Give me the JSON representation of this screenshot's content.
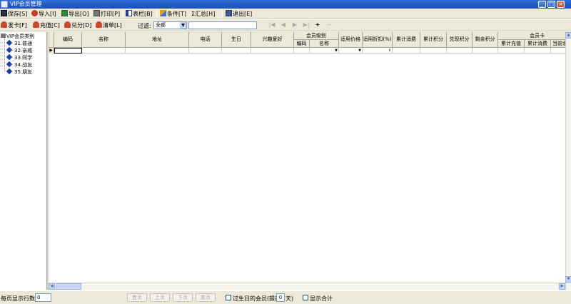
{
  "window": {
    "title": "VIP会员管理",
    "min": "_",
    "max": "□",
    "close": "×"
  },
  "toolbar1": [
    {
      "label": "保存[S]",
      "icon": "save-icon"
    },
    {
      "label": "导入[I]",
      "icon": "import-icon"
    },
    {
      "label": "导出[O]",
      "icon": "export-icon"
    },
    {
      "label": "打印[P]",
      "icon": "print-icon"
    },
    {
      "label": "表栏[B]",
      "icon": "columns-icon"
    },
    {
      "label": "条件[T]",
      "icon": "condition-icon"
    },
    {
      "label": "汇总[H]",
      "icon": "sigma-icon",
      "glyph": "Σ"
    },
    {
      "label": "退出[E]",
      "icon": "exit-icon"
    }
  ],
  "toolbar2": {
    "buttons": [
      {
        "label": "发卡[F]",
        "icon": "issue-card-icon"
      },
      {
        "label": "充值[C]",
        "icon": "recharge-icon"
      },
      {
        "label": "兑分[D]",
        "icon": "redeem-icon"
      },
      {
        "label": "清单[L]",
        "icon": "list-icon"
      }
    ],
    "filter_label": "过滤:",
    "filter_value": "全部",
    "filter_text": "",
    "nav": [
      "|◀",
      "◀",
      "▶",
      "▶|",
      "+",
      "−"
    ]
  },
  "tree": {
    "root": "VIP会员类别",
    "items": [
      "31.普通",
      "32.亲戚",
      "33.同学",
      "34.战友",
      "35.朋友"
    ]
  },
  "grid": {
    "headers": [
      "编码",
      "名称",
      "地址",
      "电话",
      "生日",
      "兴趣爱好"
    ],
    "group_level": {
      "title": "会员级别",
      "sub": [
        "编码",
        "名称"
      ]
    },
    "headers2": [
      "适用价格",
      "适用折扣(%)",
      "累计消费",
      "累计积分",
      "兑现积分",
      "剩余积分"
    ],
    "group_card": {
      "title": "会员卡",
      "sub": [
        "累计充值",
        "累计消费",
        "当前余额"
      ]
    },
    "row_indicator": "▶"
  },
  "status": {
    "rows_label": "每页显示行数:",
    "rows_value": "0",
    "pager": [
      "首页",
      "上页",
      "下页",
      "尾页"
    ],
    "birthday_label": "过生日的会员(提前",
    "birthday_days": "0",
    "days_unit": "天)",
    "show_total_label": "显示合计"
  }
}
